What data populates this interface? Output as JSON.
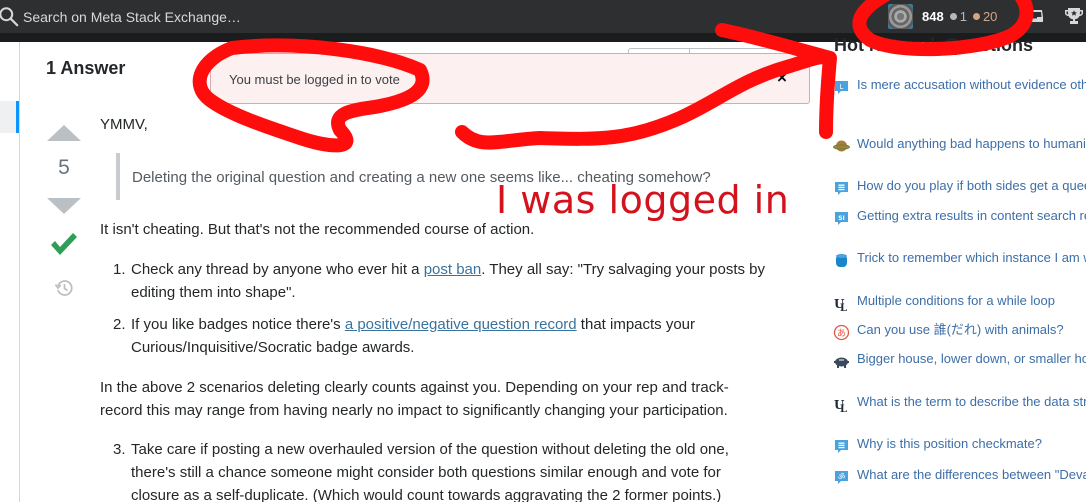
{
  "topbar": {
    "search_placeholder": "Search on Meta Stack Exchange…",
    "reputation": "848",
    "silver_badges": "1",
    "bronze_badges": "20"
  },
  "main": {
    "answers_header": "1 Answer",
    "toast": {
      "message": "You must be logged in to vote",
      "close": "×"
    },
    "answer": {
      "score": "5",
      "accepted": true,
      "greeting": "YMMV,",
      "quote": "Deleting the original question and creating a new one seems like... cheating somehow?",
      "p1": "It isn't cheating. But that's not the recommended course of action.",
      "list1": [
        {
          "num": "1.",
          "before": "Check any thread by anyone who ever hit a ",
          "link": "post ban",
          "after": ". They all say: \"Try salvaging your posts by editing them into shape\"."
        },
        {
          "num": "2.",
          "before": "If you like badges notice there's ",
          "link": "a positive/negative question record",
          "after": " that impacts your Curious/Inquisitive/Socratic badge awards."
        }
      ],
      "p2": "In the above 2 scenarios deleting clearly counts against you. Depending on your rep and track-record this may range from having nearly no impact to significantly changing your participation.",
      "list2": [
        {
          "num": "3.",
          "text": "Take care if posting a new overhauled version of the question without deleting the old one, there's still a chance someone might consider both questions similar enough and vote for closure as a self-duplicate. (Which would count towards aggravating the 2 former points.)"
        }
      ]
    }
  },
  "sidebar": {
    "title": "Hot Network Questions",
    "items": [
      {
        "icon": "law-site-icon",
        "text": "Is mere accusation without evidence other than testimony of the accuser, grounds for arrest in the UK?"
      },
      {
        "icon": "worldbuilding-site-icon",
        "text": "Would anything bad happens to humanity if quantum tunneling stopped working overnight?"
      },
      {
        "icon": "chess-site-icon",
        "text": "How do you play if both sides get a queen?"
      },
      {
        "icon": "sharepoint-site-icon",
        "text": "Getting extra results in content search results with Azure Search"
      },
      {
        "icon": "database-site-icon",
        "text": "Trick to remember which instance I am working with"
      },
      {
        "icon": "unix-linux-site-icon",
        "text": "Multiple conditions for a while loop"
      },
      {
        "icon": "japanese-site-icon",
        "text": "Can you use 誰(だれ) with animals?"
      },
      {
        "icon": "personal-finance-site-icon",
        "text": "Bigger house, lower down, or smaller house, more down"
      },
      {
        "icon": "unix-linux-site-icon",
        "text": "What is the term to describe the data structure Naming method common in Bash?"
      },
      {
        "icon": "chess-site-icon",
        "text": "Why is this position checkmate?"
      },
      {
        "icon": "hinduism-site-icon",
        "text": "What are the differences between \"Deva\", \"Bhagavan\", and \"Ishvara\"?"
      }
    ]
  },
  "annotation": {
    "text": "I was logged in",
    "color": "#d2131e"
  },
  "colors": {
    "topbar": "#2d2f31",
    "link": "#39739d",
    "accepted": "#2f9e57",
    "toast_bg": "#fcf0f1",
    "toast_border": "#e2a5ac"
  }
}
